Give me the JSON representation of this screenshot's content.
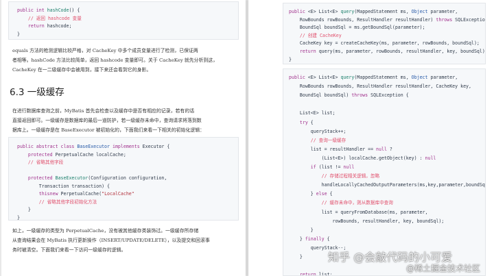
{
  "left": {
    "code1": [
      [
        [
          "kw",
          "public "
        ],
        [
          "kw",
          "int "
        ],
        [
          "nm",
          "hashCode"
        ],
        [
          "",
          "() {"
        ]
      ],
      [
        [
          "",
          "    "
        ],
        [
          "cm",
          "// 返回 hashcode 变量"
        ]
      ],
      [
        [
          "",
          "    "
        ],
        [
          "kw",
          "return "
        ],
        [
          "",
          "hashcode;"
        ]
      ],
      [
        [
          "",
          "}"
        ]
      ]
    ],
    "para1": [
      "equals 方法的枪测逻辑比较严格，对 CacheKey 中多个成员变量进行了检测，已保证两",
      "者相等。hashCode 方法比较简单，返回 hashcode 变量即可。关于 CacheKey 就先分析到这，",
      "CacheKey 在一二级缓存中会被用到，接下来还会看到它的身影。"
    ],
    "heading": "6.3 一级缓存",
    "para2": [
      "在进行数据库查询之前，MyBatis 首先会检查以及缓存中是否有相应的记录，若有的话",
      "直接返回即可。一级缓存是数据库的最后一道防护，若一级缓存未命中，查询请求将落到数",
      "据库上。一级缓存是在 BaseExecutor 被初始化的，下面我们来看一下相关的初始化逻辑："
    ],
    "code2": [
      [
        [
          "kw",
          "public "
        ],
        [
          "kw",
          "abstract "
        ],
        [
          "kw",
          "class "
        ],
        [
          "ty",
          "BaseExecutor "
        ],
        [
          "kw",
          "implements "
        ],
        [
          "",
          "Executor {"
        ]
      ],
      [
        [
          "",
          "    "
        ],
        [
          "kw",
          "protected "
        ],
        [
          "",
          "PerpetualCache localCache;"
        ]
      ],
      [
        [
          "",
          "    "
        ],
        [
          "cm",
          "// 省略其他字段"
        ]
      ],
      [
        [
          "",
          ""
        ]
      ],
      [
        [
          "",
          "    "
        ],
        [
          "kw",
          "protected "
        ],
        [
          "nm",
          "BaseExecutor"
        ],
        [
          "",
          "(Configuration configuration,"
        ]
      ],
      [
        [
          "",
          "        Transaction transaction) {"
        ]
      ],
      [
        [
          "",
          "        "
        ],
        [
          "kw",
          "this"
        ],
        [
          ".localCache = "
        ],
        [
          "kw",
          "new "
        ],
        [
          "",
          "PerpetualCache("
        ],
        [
          "st",
          "\"LocalCache\""
        ],
        [
          ");"
        ]
      ],
      [
        [
          "",
          "        "
        ],
        [
          "cm",
          "// 省略其他字段初始化方法"
        ]
      ],
      [
        [
          "",
          "    }"
        ]
      ],
      [
        [
          "",
          "}"
        ]
      ]
    ],
    "para3": [
      "如上，一级缓存的类型为 PerpetualCache，没有被其他缓存类装饰过。一级缓存所存储",
      "从查询结果会在 MyBatis 执行更新操作（INSERT/UPDATE/DELETE），以及提交和回滚事",
      "务时被清空。下面我们来看一下访问一级缓存的逻辑。"
    ]
  },
  "right": {
    "code1": [
      [
        [
          "kw",
          "public "
        ],
        [
          "",
          "<E> List<E> "
        ],
        [
          "nm",
          "query"
        ],
        [
          "",
          "(MappedStatement ms, "
        ],
        [
          "ty",
          "Object "
        ],
        [
          "",
          "parameter,"
        ]
      ],
      [
        [
          "",
          "    RowBounds rowBounds, ResultHandler resultHandler) "
        ],
        [
          "kw",
          "throws "
        ],
        [
          "",
          "SQLException {"
        ]
      ],
      [
        [
          "",
          "    BoundSql boundSql = ms.getBoundSql(parameter);"
        ]
      ],
      [
        [
          "",
          "    "
        ],
        [
          "cm",
          "// 创建 CacheKey"
        ]
      ],
      [
        [
          "",
          "    CacheKey key = createCacheKey(ms, parameter, rowBounds, boundSql);"
        ]
      ],
      [
        [
          "",
          "    "
        ],
        [
          "kw",
          "return "
        ],
        [
          "",
          "query(ms, parameter, rowBounds, resultHandler, key, boundSql);"
        ]
      ],
      [
        [
          "",
          "}"
        ]
      ]
    ],
    "code2": [
      [
        [
          "kw",
          "public "
        ],
        [
          "",
          "<E> List<E> "
        ],
        [
          "nm",
          "query"
        ],
        [
          "",
          "(MappedStatement ms, "
        ],
        [
          "ty",
          "Object "
        ],
        [
          "",
          "parameter,"
        ]
      ],
      [
        [
          "",
          "    RowBounds rowBounds, ResultHandler resultHandler, CacheKey key,"
        ]
      ],
      [
        [
          "",
          "    BoundSql boundSql) "
        ],
        [
          "kw",
          "throws "
        ],
        [
          "",
          "SQLException {"
        ]
      ],
      [
        [
          "",
          ""
        ]
      ],
      [
        [
          "",
          "    List<E> list;"
        ]
      ],
      [
        [
          "",
          "    "
        ],
        [
          "kw",
          "try "
        ],
        [
          "",
          "{"
        ]
      ],
      [
        [
          "",
          "        queryStack++;"
        ]
      ],
      [
        [
          "",
          "        "
        ],
        [
          "cm",
          "// 查询一级缓存"
        ]
      ],
      [
        [
          "",
          "        list = resultHandler == "
        ],
        [
          "kw",
          "null "
        ],
        [
          "",
          "?"
        ]
      ],
      [
        [
          "",
          "            (List<E>) localCache.getObject(key) : "
        ],
        [
          "kw",
          "null"
        ],
        [
          ";"
        ]
      ],
      [
        [
          "",
          "        "
        ],
        [
          "kw",
          "if "
        ],
        [
          "",
          "(list != "
        ],
        [
          "kw",
          "null"
        ],
        [
          ") {"
        ]
      ],
      [
        [
          "",
          "            "
        ],
        [
          "cm",
          "// 存储过程相关逻辑，忽略"
        ]
      ],
      [
        [
          "",
          "            handleLocallyCachedOutputParameters(ms,key,parameter,boundSql);"
        ]
      ],
      [
        [
          "",
          "        } "
        ],
        [
          "kw",
          "else "
        ],
        [
          "",
          "{"
        ]
      ],
      [
        [
          "",
          "            "
        ],
        [
          "cm",
          "// 缓存未命中，则从数据库中查询"
        ]
      ],
      [
        [
          "",
          "            list = queryFromDatabase(ms, parameter,"
        ]
      ],
      [
        [
          "",
          "                rowBounds, resultHandler, key, boundSql);"
        ]
      ],
      [
        [
          "",
          "        }"
        ]
      ],
      [
        [
          "",
          "    } "
        ],
        [
          "kw",
          "finally "
        ],
        [
          "",
          "{"
        ]
      ],
      [
        [
          "",
          "        queryStack--;"
        ]
      ],
      [
        [
          "",
          "    }"
        ]
      ],
      [
        [
          "",
          ""
        ]
      ],
      [
        [
          "",
          "    "
        ],
        [
          "kw",
          "return "
        ],
        [
          "",
          "list;"
        ]
      ]
    ]
  },
  "watermark": {
    "line1": "知乎 @会敲代码的小可爱",
    "line2": "@稀土掘金技术社区"
  }
}
